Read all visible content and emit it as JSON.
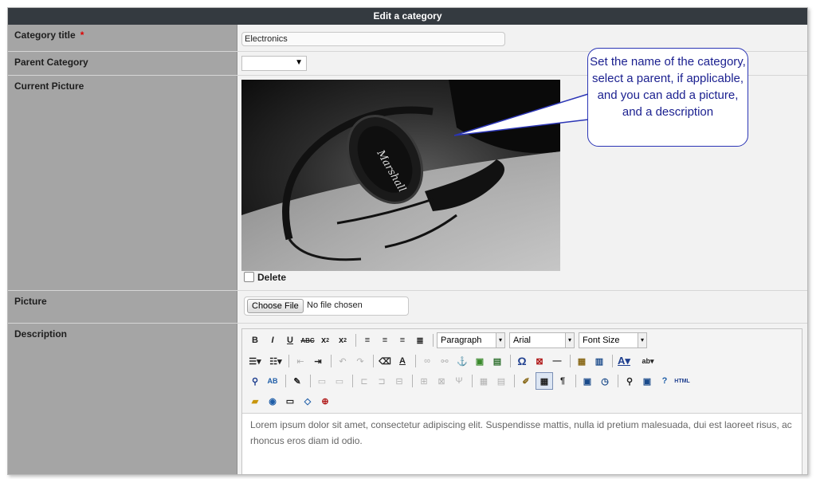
{
  "header": {
    "title": "Edit a category"
  },
  "form": {
    "category_title_label": "Category title",
    "required_mark": "*",
    "category_title_value": "Electronics",
    "parent_category_label": "Parent Category",
    "parent_category_value": "",
    "current_picture_label": "Current Picture",
    "delete_label": "Delete",
    "picture_label": "Picture",
    "choose_file_label": "Choose File",
    "no_file_text": "No file chosen",
    "description_label": "Description"
  },
  "editor": {
    "format_value": "Paragraph",
    "font_value": "Arial",
    "size_value": "Font Size",
    "content": "Lorem ipsum dolor sit amet, consectetur adipiscing elit. Suspendisse mattis, nulla id pretium malesuada, dui est laoreet risus, ac rhoncus eros diam id odio.",
    "icons_row1": [
      "bold-icon",
      "italic-icon",
      "underline-icon",
      "strikethrough-icon",
      "subscript-icon",
      "superscript-icon",
      "align-left-icon",
      "align-center-icon",
      "align-right-icon",
      "align-justify-icon"
    ],
    "icons_row2": [
      "bullet-list-icon",
      "numbered-list-icon",
      "outdent-icon",
      "indent-icon",
      "undo-icon",
      "redo-icon",
      "eraser-icon",
      "cleanup-icon",
      "link-icon",
      "unlink-icon",
      "anchor-icon",
      "image-icon",
      "media-icon",
      "special-char-icon",
      "iespell-icon",
      "horizontal-rule-icon",
      "paste-text-icon",
      "paste-word-icon",
      "font-color-icon",
      "highlight-icon"
    ],
    "icons_row3": [
      "find-icon",
      "replace-icon",
      "edit-icon",
      "insert-row-icon",
      "table-props-icon",
      "insert-column-icon",
      "delete-icon",
      "merge-icon",
      "split-icon",
      "style-icon",
      "visual-aid-icon",
      "table-icon",
      "pilcrow-icon",
      "date-icon",
      "time-icon",
      "preview-icon",
      "fullscreen-icon",
      "help-icon",
      "html-icon"
    ],
    "icons_row4": [
      "template-icon",
      "globe-icon",
      "page-break-icon",
      "code-icon",
      "uk-flag-icon"
    ],
    "html_label": "HTML"
  },
  "callout": {
    "text": "Set the name of the category, select a parent, if applicable, and you can add a picture, and a description"
  },
  "image": {
    "brand_text": "Marshall"
  }
}
